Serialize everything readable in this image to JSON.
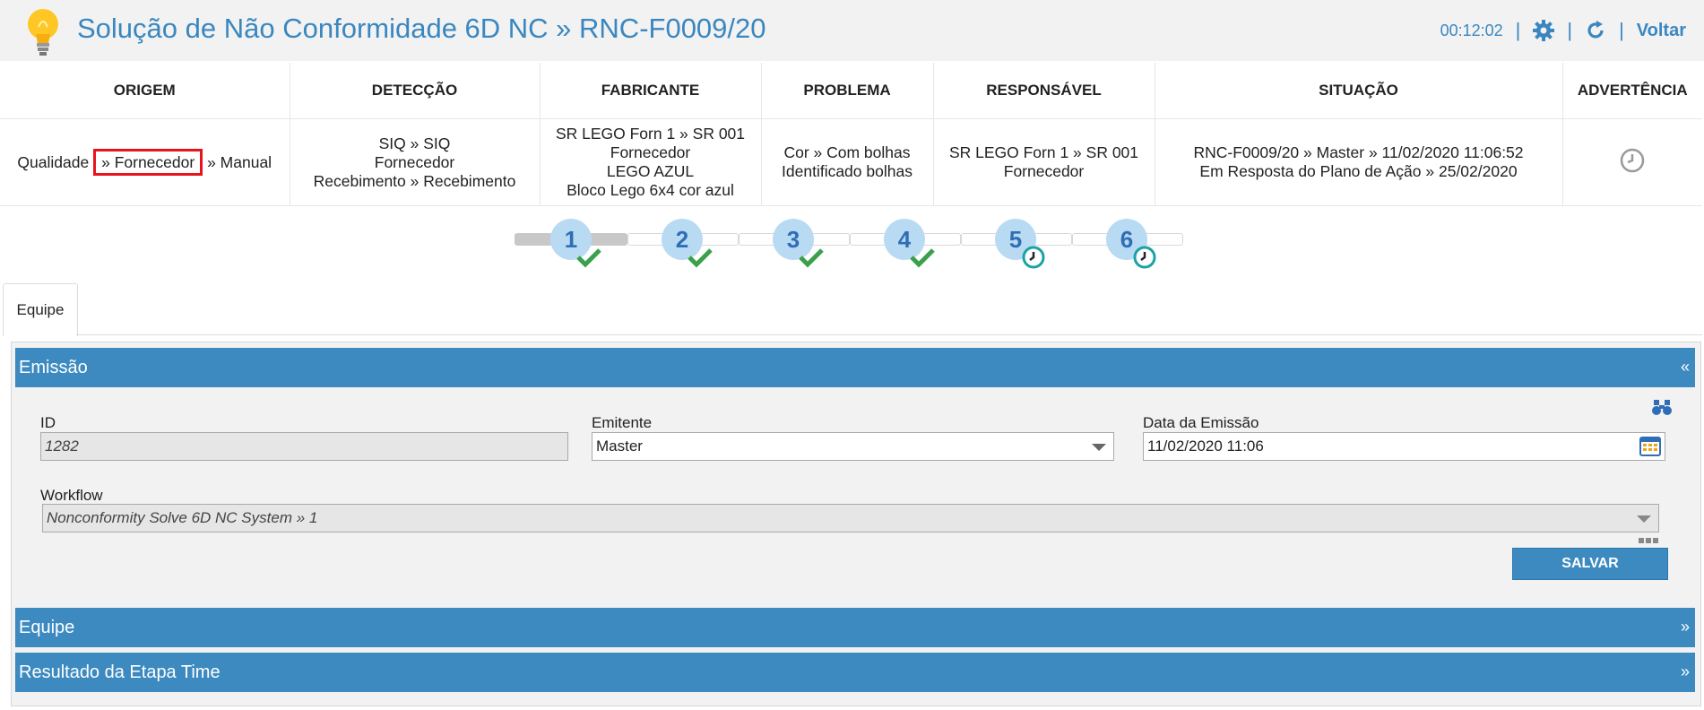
{
  "header": {
    "title": "Solução de Não Conformidade 6D NC » RNC-F0009/20",
    "timer": "00:12:02",
    "separator": "|",
    "back_label": "Voltar"
  },
  "info_table": {
    "headers": [
      "ORIGEM",
      "DETECÇÃO",
      "FABRICANTE",
      "PROBLEMA",
      "RESPONSÁVEL",
      "SITUAÇÃO",
      "ADVERTÊNCIA"
    ],
    "origem": {
      "part1": "Qualidade",
      "sep1": "»",
      "highlight": "Fornecedor",
      "sep2": "»",
      "part3": "Manual"
    },
    "deteccao": [
      "SIQ » SIQ",
      "Fornecedor",
      "Recebimento » Recebimento"
    ],
    "fabricante": [
      "SR LEGO Forn 1 » SR 001",
      "Fornecedor",
      "LEGO AZUL",
      "Bloco Lego 6x4 cor azul"
    ],
    "problema": [
      "Cor » Com bolhas",
      "Identificado bolhas"
    ],
    "responsavel": [
      "SR LEGO Forn 1 » SR 001",
      "Fornecedor"
    ],
    "situacao": [
      "RNC-F0009/20 » Master » 11/02/2020 11:06:52",
      "Em Resposta do Plano de Ação » 25/02/2020"
    ]
  },
  "steps": [
    {
      "number": "1",
      "status": "done"
    },
    {
      "number": "2",
      "status": "done"
    },
    {
      "number": "3",
      "status": "done"
    },
    {
      "number": "4",
      "status": "done"
    },
    {
      "number": "5",
      "status": "pending"
    },
    {
      "number": "6",
      "status": "pending"
    }
  ],
  "tabs": {
    "active": "Equipe"
  },
  "emissao": {
    "title": "Emissão",
    "collapse_symbol": "«",
    "id_label": "ID",
    "id_value": "1282",
    "emitente_label": "Emitente",
    "emitente_value": "Master",
    "data_label": "Data da Emissão",
    "data_value": "11/02/2020 11:06",
    "workflow_label": "Workflow",
    "workflow_value": "Nonconformity Solve 6D NC System » 1",
    "save_label": "SALVAR"
  },
  "panels": {
    "equipe_title": "Equipe",
    "resultado_title": "Resultado da Etapa Time",
    "expand_symbol": "»"
  },
  "colors": {
    "accent": "#3c8ac0",
    "title": "#3a87c0",
    "highlight_border": "#e8141a",
    "check": "#3aa04a"
  }
}
